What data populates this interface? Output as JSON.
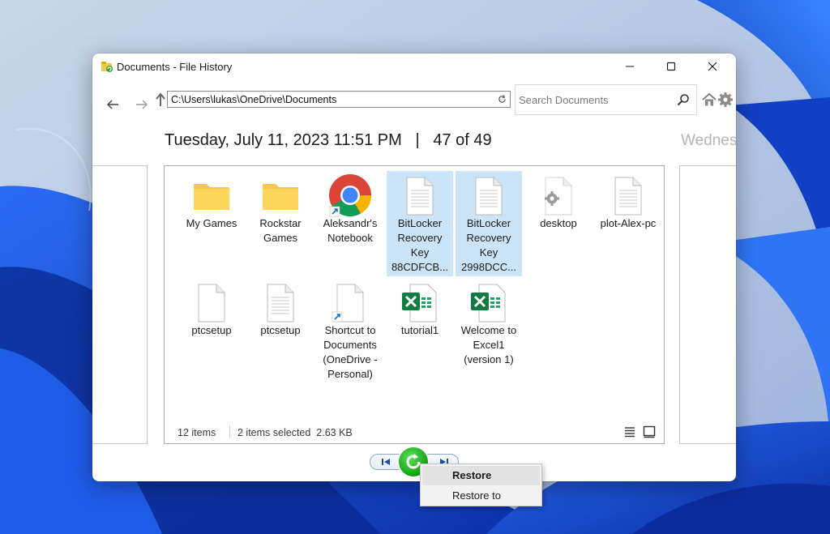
{
  "window": {
    "title": "Documents - File History"
  },
  "toolbar": {
    "address": "C:\\Users\\lukas\\OneDrive\\Documents",
    "search_placeholder": "Search Documents"
  },
  "timeline": {
    "date": "Tuesday, July 11, 2023 11:51 PM",
    "separator": "|",
    "position": "47 of 49",
    "next_date_partial": "Wednes"
  },
  "files": [
    {
      "label": "My Games",
      "type": "folder",
      "selected": false
    },
    {
      "label": "Rockstar Games",
      "type": "folder",
      "selected": false
    },
    {
      "label": "Aleksandr's Notebook",
      "type": "chrome-shortcut",
      "selected": false
    },
    {
      "label": "BitLocker Recovery Key 88CDFCB...",
      "type": "text",
      "selected": true
    },
    {
      "label": "BitLocker Recovery Key 2998DCC...",
      "type": "text",
      "selected": true
    },
    {
      "label": "desktop",
      "type": "settings-file",
      "selected": false
    },
    {
      "label": "plot-Alex-pc",
      "type": "text",
      "selected": false
    },
    {
      "label": "ptcsetup",
      "type": "blank",
      "selected": false
    },
    {
      "label": "ptcsetup",
      "type": "text",
      "selected": false
    },
    {
      "label": "Shortcut to Documents (OneDrive - Personal)",
      "type": "shortcut",
      "selected": false
    },
    {
      "label": "tutorial1",
      "type": "excel",
      "selected": false
    },
    {
      "label": "Welcome to Excel1 (version 1)",
      "type": "excel",
      "selected": false
    }
  ],
  "status": {
    "item_count": "12 items",
    "selection": "2 items selected  2.63 KB"
  },
  "context_menu": {
    "restore": "Restore",
    "restore_to": "Restore to"
  },
  "colors": {
    "accent_selection": "#cce4f7",
    "restore_green": "#10a010",
    "wallpaper_blue": "#1a4fd8"
  }
}
